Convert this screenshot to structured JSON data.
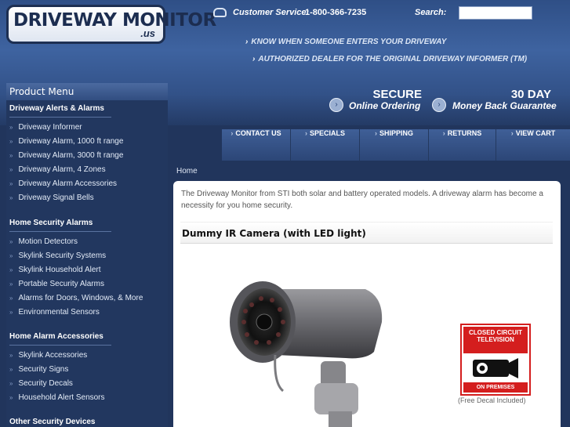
{
  "header": {
    "logo_main": "DRIVEWAY MONITOR",
    "logo_sub": ".us",
    "customer_service_label": "Customer Service:",
    "phone": "1-800-366-7235",
    "search_label": "Search:",
    "search_value": "",
    "taglines": [
      "KNOW WHEN SOMEONE ENTERS YOUR DRIVEWAY",
      "AUTHORIZED DEALER FOR THE ORIGINAL DRIVEWAY INFORMER"
    ],
    "tm": "(TM)",
    "promo": [
      {
        "big": "SECURE",
        "small": "Online Ordering"
      },
      {
        "big": "30 DAY",
        "small": "Money Back Guarantee"
      }
    ]
  },
  "sidebar": {
    "title": "Product Menu",
    "sections": [
      {
        "heading": "Driveway Alerts & Alarms",
        "items": [
          "Driveway Informer",
          "Driveway Alarm, 1000 ft range",
          "Driveway Alarm, 3000 ft range",
          "Driveway Alarm, 4 Zones",
          "Driveway Alarm Accessories",
          "Driveway Signal Bells"
        ]
      },
      {
        "heading": "Home Security Alarms",
        "items": [
          "Motion Detectors",
          "Skylink Security Systems",
          "Skylink Household Alert",
          "Portable Security Alarms",
          "Alarms for Doors, Windows, & More",
          "Environmental Sensors"
        ]
      },
      {
        "heading": "Home Alarm Accessories",
        "items": [
          "Skylink Accessories",
          "Security Signs",
          "Security Decals",
          "Household Alert Sensors"
        ]
      },
      {
        "heading": "Other Security Devices",
        "items": []
      }
    ]
  },
  "nav": [
    "CONTACT US",
    "SPECIALS",
    "SHIPPING",
    "RETURNS",
    "VIEW CART"
  ],
  "breadcrumb": "Home",
  "content": {
    "intro": "The Driveway Monitor from STI both solar and battery operated models. A driveway alarm has become a necessity for you home security.",
    "product_title": "Dummy IR Camera (with LED light)",
    "decal_top": "CLOSED CIRCUIT TELEVISION",
    "decal_bottom": "ON PREMISES",
    "decal_caption": "(Free Decal Included)"
  },
  "colors": {
    "page_bg": "#21355c",
    "header": "#3e63a0",
    "decal_red": "#d41e1e"
  }
}
